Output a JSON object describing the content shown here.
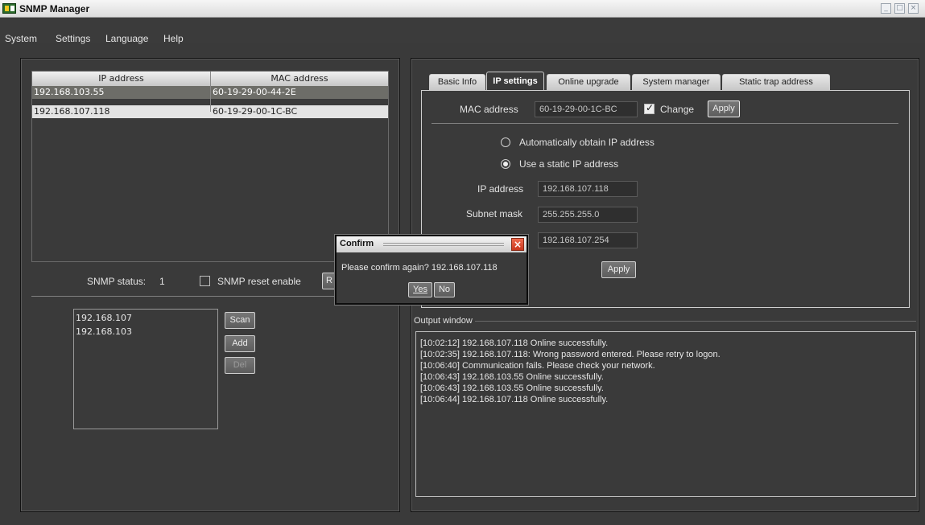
{
  "window": {
    "title": "SNMP Manager"
  },
  "menu": [
    "System",
    "Settings",
    "Language",
    "Help"
  ],
  "device_table": {
    "columns": [
      "IP address",
      "MAC address"
    ],
    "rows": [
      {
        "ip": "192.168.103.55",
        "mac": "60-19-29-00-44-2E"
      },
      {
        "ip": "192.168.107.118",
        "mac": "60-19-29-00-1C-BC"
      }
    ]
  },
  "snmp": {
    "status_label": "SNMP status:",
    "status_value": "1",
    "reset_enable_label": "SNMP reset enable",
    "reset_button_partial": "R"
  },
  "scan_list": {
    "items": [
      "192.168.107",
      "192.168.103"
    ],
    "buttons": {
      "scan": "Scan",
      "add": "Add",
      "del": "Del"
    }
  },
  "tabs": [
    "Basic Info",
    "IP settings",
    "Online upgrade",
    "System manager",
    "Static trap address"
  ],
  "ip_settings": {
    "mac_label": "MAC address",
    "mac_value": "60-19-29-00-1C-BC",
    "change_label": "Change",
    "apply_label": "Apply",
    "auto_label": "Automatically obtain IP address",
    "static_label": "Use a static IP address",
    "ip_label": "IP address",
    "ip_value": "192.168.107.118",
    "mask_label": "Subnet mask",
    "mask_value": "255.255.255.0",
    "gateway_value": "192.168.107.254",
    "apply2_label": "Apply"
  },
  "output": {
    "title": "Output window",
    "lines": [
      "[10:02:12]  192.168.107.118 Online successfully.",
      "[10:02:35]  192.168.107.118: Wrong password entered. Please retry to logon.",
      "[10:06:40]    Communication fails. Please check your network.",
      "[10:06:43]  192.168.103.55 Online successfully.",
      "[10:06:43]  192.168.103.55 Online successfully.",
      "[10:06:44]  192.168.107.118 Online successfully."
    ]
  },
  "dialog": {
    "title": "Confirm",
    "message": "Please confirm again? 192.168.107.118",
    "yes": "Yes",
    "no": "No"
  }
}
